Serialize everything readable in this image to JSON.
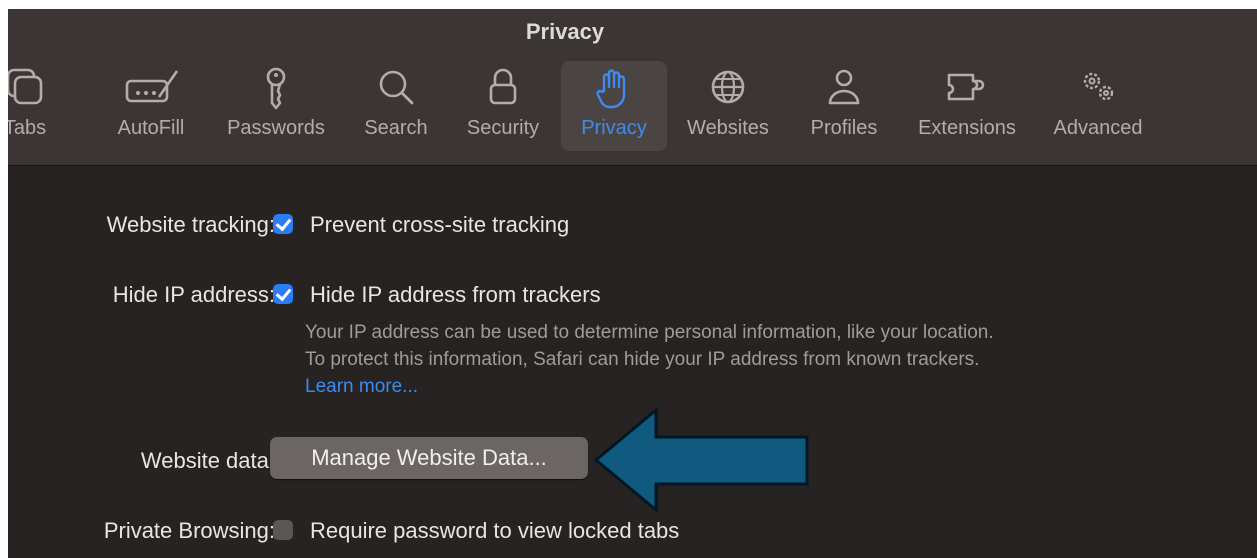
{
  "window": {
    "title": "Privacy"
  },
  "tabs": [
    {
      "label": "Tabs",
      "icon": "tabs-icon"
    },
    {
      "label": "AutoFill",
      "icon": "autofill-icon"
    },
    {
      "label": "Passwords",
      "icon": "key-icon"
    },
    {
      "label": "Search",
      "icon": "search-icon"
    },
    {
      "label": "Security",
      "icon": "lock-icon"
    },
    {
      "label": "Privacy",
      "icon": "hand-icon",
      "active": true
    },
    {
      "label": "Websites",
      "icon": "globe-icon"
    },
    {
      "label": "Profiles",
      "icon": "person-icon"
    },
    {
      "label": "Extensions",
      "icon": "puzzle-icon"
    },
    {
      "label": "Advanced",
      "icon": "gears-icon"
    }
  ],
  "settings": {
    "website_tracking": {
      "label": "Website tracking:",
      "option": "Prevent cross-site tracking",
      "checked": true
    },
    "hide_ip": {
      "label": "Hide IP address:",
      "option": "Hide IP address from trackers",
      "checked": true,
      "help_text": "Your IP address can be used to determine personal information, like your location. To protect this information, Safari can hide your IP address from known trackers.",
      "learn_more": "Learn more..."
    },
    "website_data": {
      "label": "Website data:",
      "button": "Manage Website Data..."
    },
    "private_browsing": {
      "label": "Private Browsing:",
      "option": "Require password to view locked tabs",
      "checked": false
    }
  },
  "colors": {
    "accent": "#2b7df6",
    "arrow": "#0f5a7e",
    "arrow_border": "#001724"
  }
}
